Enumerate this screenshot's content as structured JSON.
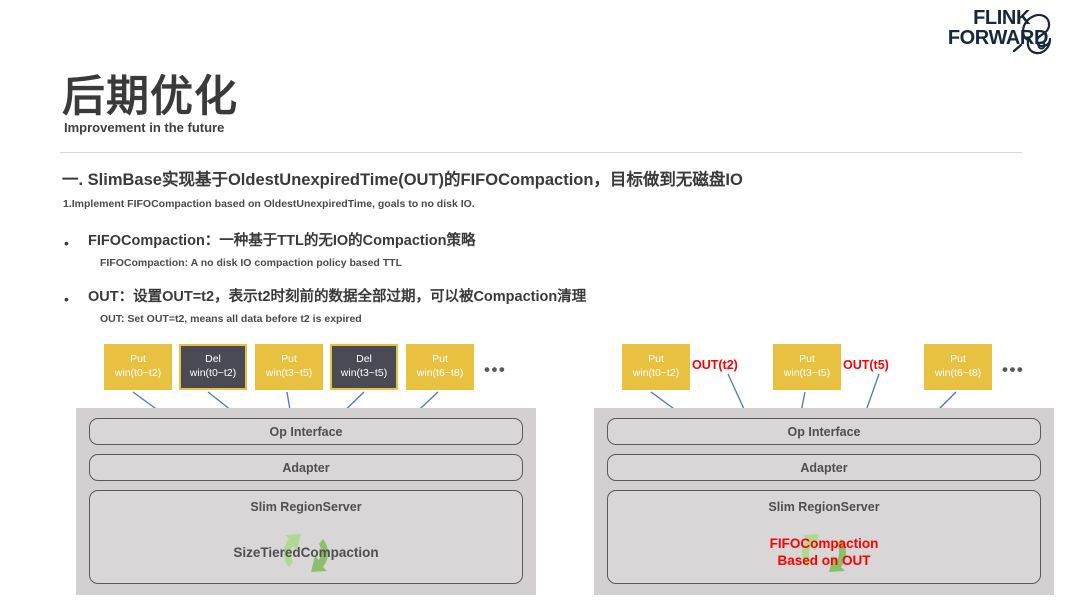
{
  "brand": {
    "logo_line_1": "FLINK",
    "logo_line_2": "FORWARD",
    "icon": "squirrel-icon",
    "color": "#16283c"
  },
  "header": {
    "title": "后期优化",
    "subtitle": "Improvement in the future"
  },
  "section": {
    "heading": "一. SlimBase实现基于OldestUnexpiredTime(OUT)的FIFOCompaction，目标做到无磁盘IO",
    "sub": "1.Implement FIFOCompaction based on OldestUnexpiredTime, goals to no disk IO."
  },
  "bullets": [
    {
      "marker": "•",
      "main": "FIFOCompaction：一种基于TTL的无IO的Compaction策略",
      "sub": "FIFOCompaction: A no disk IO compaction policy based TTL"
    },
    {
      "marker": "•",
      "main": "OUT：设置OUT=t2，表示t2时刻前的数据全部过期，可以被Compaction清理",
      "sub": "OUT: Set OUT=t2, means all data before t2 is expired"
    }
  ],
  "colors": {
    "put_box": "#e8c140",
    "del_box": "#4a4a54",
    "del_border": "#e8c140",
    "panel_bg": "#d2d0d0",
    "stack_box_bg": "#d8d6d6",
    "stack_box_border": "#5a5a5a",
    "arrow_blue": "#4a76c8",
    "recycle_green": "#7db34a",
    "out_red": "#ff0000"
  },
  "diagrams": [
    {
      "id": "size-tiered",
      "ops": [
        {
          "type": "put",
          "kind": "Put",
          "win": "win(t0~t2)"
        },
        {
          "type": "del",
          "kind": "Del",
          "win": "win(t0~t2)"
        },
        {
          "type": "put",
          "kind": "Put",
          "win": "win(t3~t5)"
        },
        {
          "type": "del",
          "kind": "Del",
          "win": "win(t3~t5)"
        },
        {
          "type": "put",
          "kind": "Put",
          "win": "win(t6~t8)"
        }
      ],
      "ellipsis": "•••",
      "stack": {
        "op_interface": "Op Interface",
        "adapter": "Adapter",
        "region_server": "Slim RegionServer",
        "compaction": "SizeTieredCompaction",
        "compaction_color": "dark"
      }
    },
    {
      "id": "fifo-out",
      "ops": [
        {
          "type": "put",
          "kind": "Put",
          "win": "win(t0~t2)"
        },
        {
          "type": "out",
          "label": "OUT(t2)"
        },
        {
          "type": "put",
          "kind": "Put",
          "win": "win(t3~t5)"
        },
        {
          "type": "out",
          "label": "OUT(t5)"
        },
        {
          "type": "put",
          "kind": "Put",
          "win": "win(t6~t8)"
        }
      ],
      "ellipsis": "•••",
      "stack": {
        "op_interface": "Op Interface",
        "adapter": "Adapter",
        "region_server": "Slim RegionServer",
        "compaction": "FIFOCompaction\nBased on OUT",
        "compaction_line_1": "FIFOCompaction",
        "compaction_line_2": "Based on OUT",
        "compaction_color": "red"
      }
    }
  ]
}
